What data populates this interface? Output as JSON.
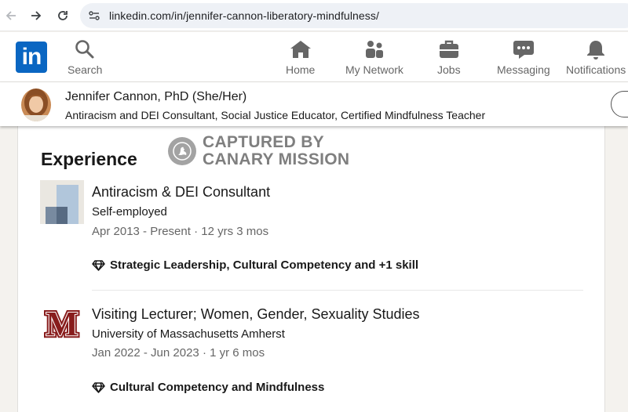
{
  "browser": {
    "url": "linkedin.com/in/jennifer-cannon-liberatory-mindfulness/"
  },
  "nav": {
    "logo": "in",
    "items": [
      {
        "label": "Search",
        "icon": "search-icon"
      },
      {
        "label": "Home",
        "icon": "home-icon"
      },
      {
        "label": "My Network",
        "icon": "network-icon"
      },
      {
        "label": "Jobs",
        "icon": "briefcase-icon"
      },
      {
        "label": "Messaging",
        "icon": "message-icon"
      },
      {
        "label": "Notifications",
        "icon": "bell-icon"
      }
    ]
  },
  "profile": {
    "name": "Jennifer Cannon, PhD",
    "pronouns": "(She/Her)",
    "headline": "Antiracism and DEI Consultant, Social Justice Educator, Certified Mindfulness Teacher"
  },
  "watermark": {
    "line1": "CAPTURED BY",
    "line2": "CANARY MISSION"
  },
  "experience": {
    "title": "Experience",
    "entries": [
      {
        "title": "Antiracism & DEI Consultant",
        "company": "Self-employed",
        "dates": "Apr 2013 - Present · 12 yrs 3 mos",
        "skills": "Strategic Leadership, Cultural Competency and +1 skill"
      },
      {
        "title": "Visiting Lecturer; Women, Gender, Sexuality Studies",
        "company": "University of Massachusetts Amherst",
        "dates": "Jan 2022 - Jun 2023 · 1 yr 6 mos",
        "skills": "Cultural Competency and Mindfulness",
        "logo_letter": "M"
      }
    ]
  },
  "colors": {
    "brand": "#0a66c2",
    "umass_maroon": "#881c1c",
    "text": "#191919",
    "muted": "#666666"
  }
}
